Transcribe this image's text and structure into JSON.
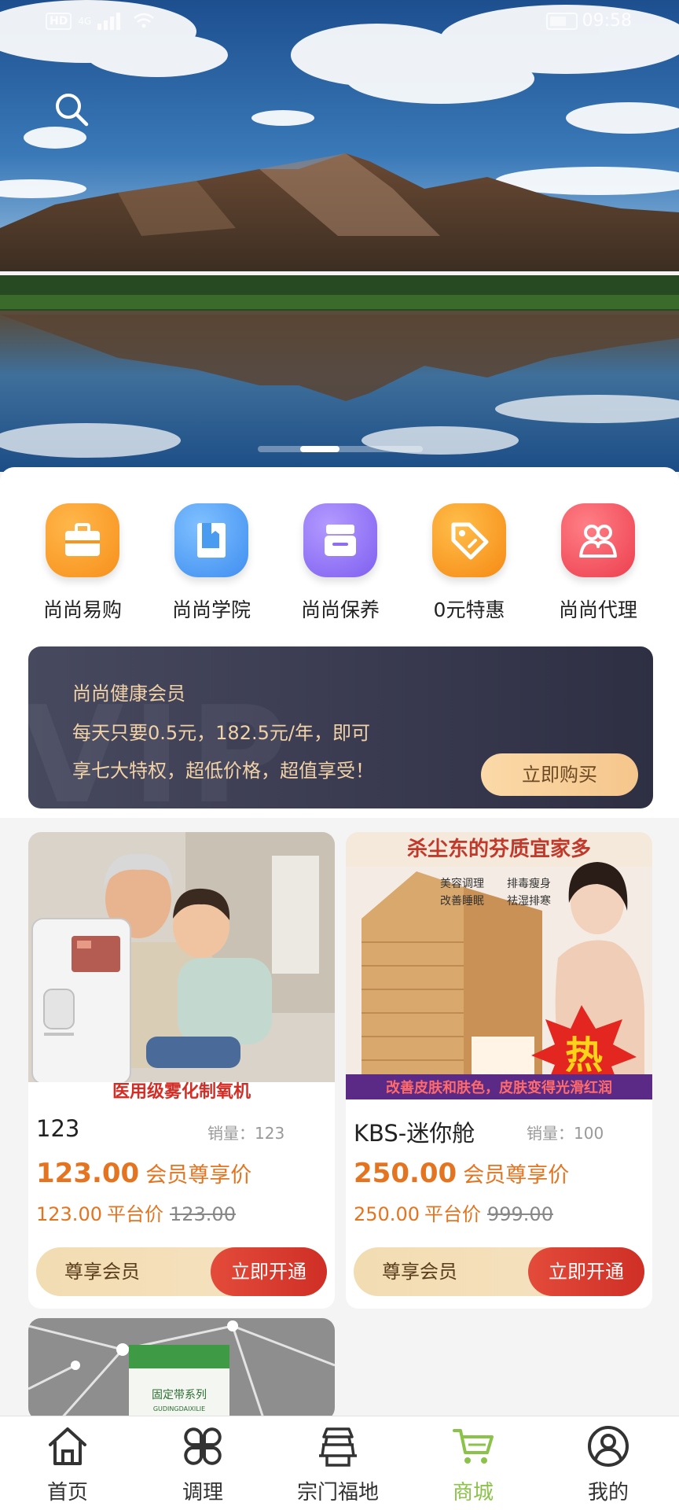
{
  "status_bar": {
    "network": "HD",
    "signal_gen": "4G",
    "time": "09:58"
  },
  "banner": {
    "slides_total": 3,
    "active_slide": 1
  },
  "categories": [
    {
      "label": "尚尚易购",
      "icon": "briefcase-icon",
      "color": "#f7961e"
    },
    {
      "label": "尚尚学院",
      "icon": "book-icon",
      "color": "#4a9cf0"
    },
    {
      "label": "尚尚保养",
      "icon": "cream-jar-icon",
      "color": "#8f6cf0"
    },
    {
      "label": "0元特惠",
      "icon": "price-tag-icon",
      "color": "#f5901c"
    },
    {
      "label": "尚尚代理",
      "icon": "group-icon",
      "color": "#ef4d5a"
    }
  ],
  "vip": {
    "title": "尚尚健康会员",
    "line1": "每天只要0.5元，182.5元/年，即可",
    "line2": "享七大特权，超低价格，超值享受！",
    "button": "立即购买",
    "watermark": "VIP"
  },
  "products": [
    {
      "name": "123",
      "sales_label": "销量：123",
      "price": "123.00",
      "price_tag": "会员尊享价",
      "platform_price": "123.00",
      "platform_label": "平台价",
      "original_price": "123.00",
      "member_label": "尊享会员",
      "open_label": "立即开通",
      "image_caption": "医用级雾化制氧机"
    },
    {
      "name": "KBS-迷你舱",
      "sales_label": "销量：100",
      "price": "250.00",
      "price_tag": "会员尊享价",
      "platform_price": "250.00",
      "platform_label": "平台价",
      "original_price": "999.00",
      "member_label": "尊享会员",
      "open_label": "立即开通",
      "image_top_text": "杀尘东的芬质宜家多",
      "image_features": [
        "美容调理",
        "排毒瘦身",
        "改善睡眠",
        "祛湿排寒"
      ],
      "image_hot": "热",
      "image_caption": "改善皮肤和肤色，皮肤变得光滑红润"
    }
  ],
  "third_product": {
    "box_text": "固定带系列",
    "box_sub": "GUDINGDAIXILIE"
  },
  "tabbar": [
    {
      "label": "首页",
      "icon": "home-icon",
      "active": false
    },
    {
      "label": "调理",
      "icon": "clover-icon",
      "active": false
    },
    {
      "label": "宗门福地",
      "icon": "pagoda-icon",
      "active": false
    },
    {
      "label": "商城",
      "icon": "cart-icon",
      "active": true
    },
    {
      "label": "我的",
      "icon": "user-icon",
      "active": false
    }
  ]
}
